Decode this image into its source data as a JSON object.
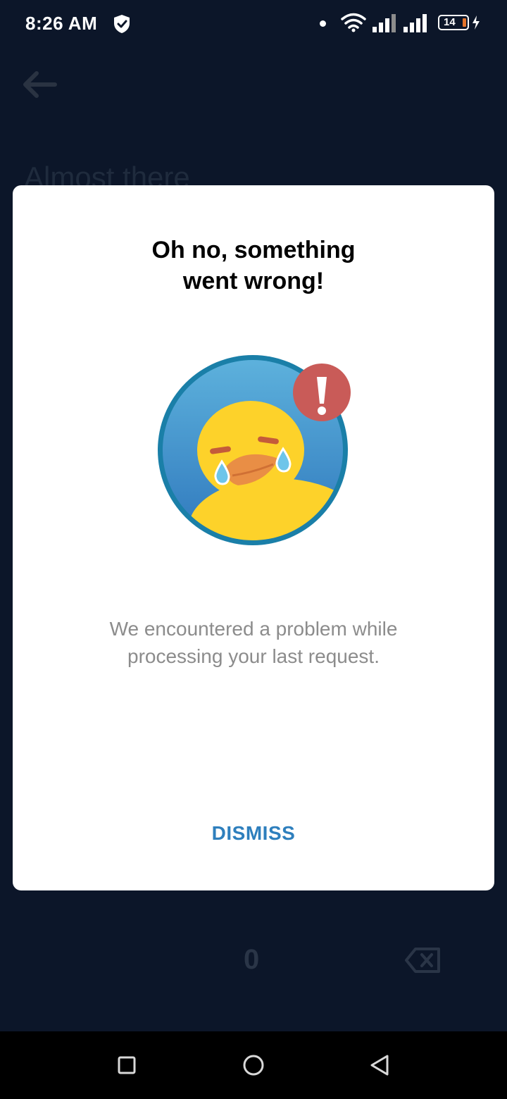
{
  "status_bar": {
    "time": "8:26 AM",
    "battery_level": "14",
    "icons": [
      "shield-icon",
      "notification-dot-icon",
      "wifi-icon",
      "signal-icon",
      "signal-icon",
      "battery-icon",
      "charging-bolt-icon"
    ]
  },
  "background_screen": {
    "title": "Almost there",
    "keypad_zero": "0",
    "icons": [
      "back-arrow-icon",
      "backspace-icon"
    ]
  },
  "dialog": {
    "title": "Oh no, something\nwent wrong!",
    "illustration": "crying-duck-illustration",
    "alert_icon": "exclamation-icon",
    "message": "We encountered a problem while\nprocessing your last request.",
    "dismiss_label": "DISMISS"
  },
  "colors": {
    "background": "#0c1629",
    "dialog_background": "#ffffff",
    "accent": "#2e7fbd",
    "alert_red": "#c95b58",
    "duck_yellow": "#fdd22a"
  },
  "nav_bar": {
    "buttons": [
      "recents-button",
      "home-button",
      "back-button"
    ]
  }
}
